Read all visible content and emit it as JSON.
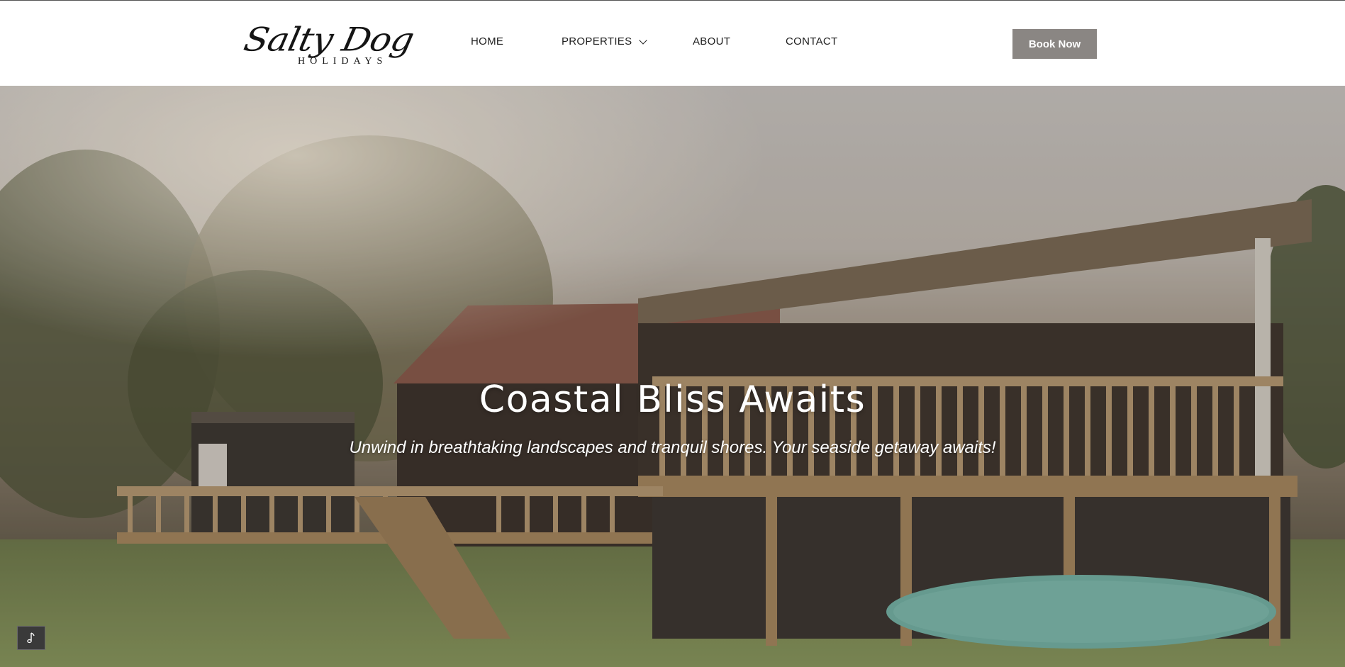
{
  "brand": {
    "logo_script": "Salty Dog",
    "logo_sub": "HOLIDAYS"
  },
  "nav": {
    "items": [
      {
        "label": "HOME"
      },
      {
        "label": "PROPERTIES",
        "has_dropdown": true
      },
      {
        "label": "ABOUT"
      },
      {
        "label": "CONTACT"
      }
    ]
  },
  "header": {
    "cta_label": "Book Now"
  },
  "hero": {
    "title": "Coastal Bliss Awaits",
    "subtitle": "Unwind in breathtaking landscapes and tranquil shores. Your seaside getaway awaits!"
  },
  "music_toggle": {
    "icon": "music-note-icon"
  },
  "colors": {
    "button_bg": "#8a8683",
    "nav_text": "#1e1e1e",
    "hero_text": "#ffffff",
    "paddleboard": "#74b5a9"
  }
}
